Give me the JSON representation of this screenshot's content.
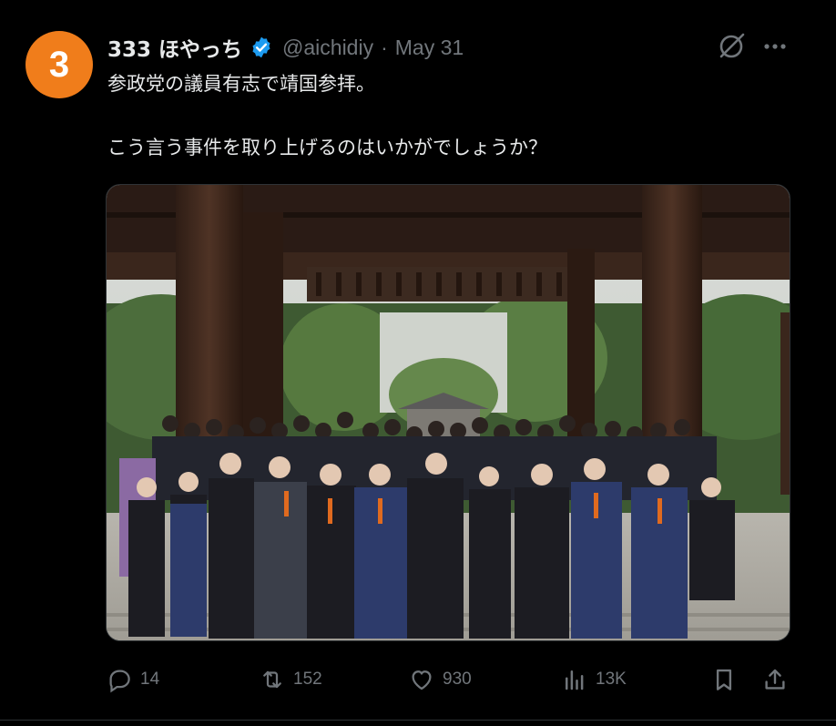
{
  "tweet": {
    "avatar_text": "3",
    "display_name": "333 ほやっち",
    "handle": "@aichidiy",
    "separator": "·",
    "date": "May 31",
    "text_line1": "参政党の議員有志で靖国参拝。",
    "text_line2": "こう言う事件を取り上げるのはいかがでしょうか？",
    "avatar_color": "#f07d1b",
    "verified_color": "#1d9bf0"
  },
  "actions": {
    "replies": "14",
    "reposts": "152",
    "likes": "930",
    "views": "13K"
  },
  "icons": [
    "grok-icon",
    "more-icon",
    "reply-icon",
    "repost-icon",
    "like-icon",
    "views-icon",
    "bookmark-icon",
    "share-icon",
    "verified-icon"
  ]
}
